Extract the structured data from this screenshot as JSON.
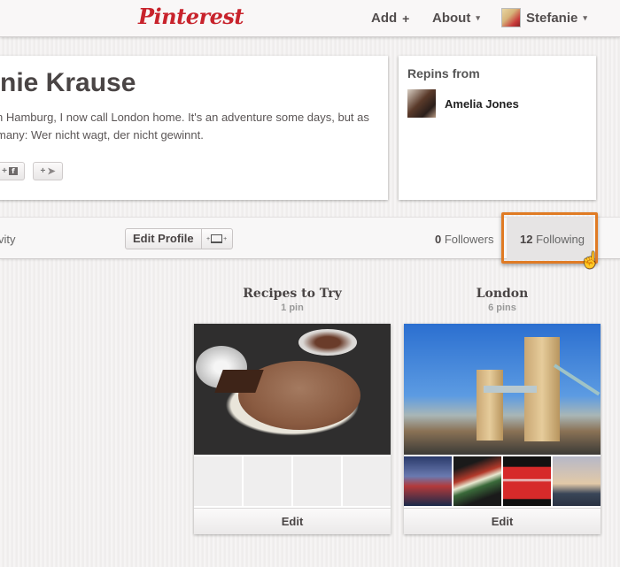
{
  "header": {
    "logo": "Pinterest",
    "nav": {
      "add_label": "Add",
      "add_icon": "+",
      "about_label": "About",
      "user_name": "Stefanie",
      "caret": "▾"
    }
  },
  "profile": {
    "name": "nie Krause",
    "bio_line1": "n Hamburg, I now call London home. It's an adventure some days, but as",
    "bio_line2": "many: Wer nicht wagt, der nicht gewinnt.",
    "social": {
      "facebook_plus": "+",
      "facebook_glyph": "f",
      "twitter_plus": "+",
      "twitter_glyph": "🐦"
    }
  },
  "repins": {
    "title": "Repins from",
    "user_name": "Amelia Jones"
  },
  "action_bar": {
    "activity_label": "vity",
    "edit_profile_label": "Edit Profile",
    "cover_arrows_left": "+",
    "cover_arrows_right": "+",
    "followers_count": "0",
    "followers_label": " Followers",
    "following_count": "12",
    "following_label": " Following",
    "highlight_color": "#e07b24"
  },
  "boards": [
    {
      "title": "Recipes to Try",
      "count": "1 pin",
      "edit_label": "Edit"
    },
    {
      "title": "London",
      "count": "6 pins",
      "edit_label": "Edit"
    }
  ],
  "cursor": "☝"
}
